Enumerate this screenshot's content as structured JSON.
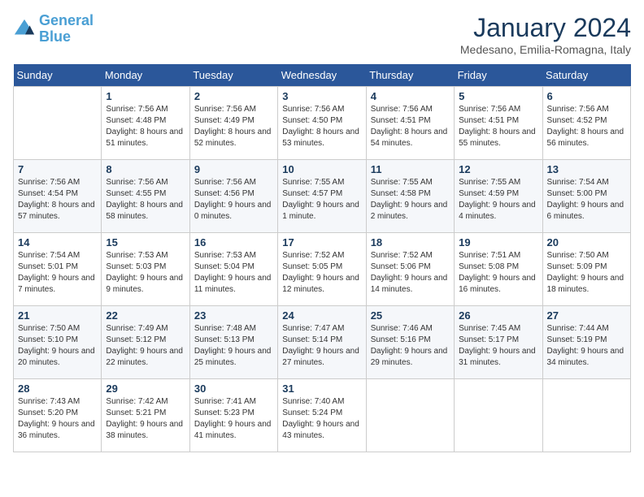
{
  "header": {
    "logo_line1": "General",
    "logo_line2": "Blue",
    "month": "January 2024",
    "location": "Medesano, Emilia-Romagna, Italy"
  },
  "days_of_week": [
    "Sunday",
    "Monday",
    "Tuesday",
    "Wednesday",
    "Thursday",
    "Friday",
    "Saturday"
  ],
  "weeks": [
    [
      {
        "day": "",
        "sunrise": "",
        "sunset": "",
        "daylight": ""
      },
      {
        "day": "1",
        "sunrise": "Sunrise: 7:56 AM",
        "sunset": "Sunset: 4:48 PM",
        "daylight": "Daylight: 8 hours and 51 minutes."
      },
      {
        "day": "2",
        "sunrise": "Sunrise: 7:56 AM",
        "sunset": "Sunset: 4:49 PM",
        "daylight": "Daylight: 8 hours and 52 minutes."
      },
      {
        "day": "3",
        "sunrise": "Sunrise: 7:56 AM",
        "sunset": "Sunset: 4:50 PM",
        "daylight": "Daylight: 8 hours and 53 minutes."
      },
      {
        "day": "4",
        "sunrise": "Sunrise: 7:56 AM",
        "sunset": "Sunset: 4:51 PM",
        "daylight": "Daylight: 8 hours and 54 minutes."
      },
      {
        "day": "5",
        "sunrise": "Sunrise: 7:56 AM",
        "sunset": "Sunset: 4:51 PM",
        "daylight": "Daylight: 8 hours and 55 minutes."
      },
      {
        "day": "6",
        "sunrise": "Sunrise: 7:56 AM",
        "sunset": "Sunset: 4:52 PM",
        "daylight": "Daylight: 8 hours and 56 minutes."
      }
    ],
    [
      {
        "day": "7",
        "sunrise": "Sunrise: 7:56 AM",
        "sunset": "Sunset: 4:54 PM",
        "daylight": "Daylight: 8 hours and 57 minutes."
      },
      {
        "day": "8",
        "sunrise": "Sunrise: 7:56 AM",
        "sunset": "Sunset: 4:55 PM",
        "daylight": "Daylight: 8 hours and 58 minutes."
      },
      {
        "day": "9",
        "sunrise": "Sunrise: 7:56 AM",
        "sunset": "Sunset: 4:56 PM",
        "daylight": "Daylight: 9 hours and 0 minutes."
      },
      {
        "day": "10",
        "sunrise": "Sunrise: 7:55 AM",
        "sunset": "Sunset: 4:57 PM",
        "daylight": "Daylight: 9 hours and 1 minute."
      },
      {
        "day": "11",
        "sunrise": "Sunrise: 7:55 AM",
        "sunset": "Sunset: 4:58 PM",
        "daylight": "Daylight: 9 hours and 2 minutes."
      },
      {
        "day": "12",
        "sunrise": "Sunrise: 7:55 AM",
        "sunset": "Sunset: 4:59 PM",
        "daylight": "Daylight: 9 hours and 4 minutes."
      },
      {
        "day": "13",
        "sunrise": "Sunrise: 7:54 AM",
        "sunset": "Sunset: 5:00 PM",
        "daylight": "Daylight: 9 hours and 6 minutes."
      }
    ],
    [
      {
        "day": "14",
        "sunrise": "Sunrise: 7:54 AM",
        "sunset": "Sunset: 5:01 PM",
        "daylight": "Daylight: 9 hours and 7 minutes."
      },
      {
        "day": "15",
        "sunrise": "Sunrise: 7:53 AM",
        "sunset": "Sunset: 5:03 PM",
        "daylight": "Daylight: 9 hours and 9 minutes."
      },
      {
        "day": "16",
        "sunrise": "Sunrise: 7:53 AM",
        "sunset": "Sunset: 5:04 PM",
        "daylight": "Daylight: 9 hours and 11 minutes."
      },
      {
        "day": "17",
        "sunrise": "Sunrise: 7:52 AM",
        "sunset": "Sunset: 5:05 PM",
        "daylight": "Daylight: 9 hours and 12 minutes."
      },
      {
        "day": "18",
        "sunrise": "Sunrise: 7:52 AM",
        "sunset": "Sunset: 5:06 PM",
        "daylight": "Daylight: 9 hours and 14 minutes."
      },
      {
        "day": "19",
        "sunrise": "Sunrise: 7:51 AM",
        "sunset": "Sunset: 5:08 PM",
        "daylight": "Daylight: 9 hours and 16 minutes."
      },
      {
        "day": "20",
        "sunrise": "Sunrise: 7:50 AM",
        "sunset": "Sunset: 5:09 PM",
        "daylight": "Daylight: 9 hours and 18 minutes."
      }
    ],
    [
      {
        "day": "21",
        "sunrise": "Sunrise: 7:50 AM",
        "sunset": "Sunset: 5:10 PM",
        "daylight": "Daylight: 9 hours and 20 minutes."
      },
      {
        "day": "22",
        "sunrise": "Sunrise: 7:49 AM",
        "sunset": "Sunset: 5:12 PM",
        "daylight": "Daylight: 9 hours and 22 minutes."
      },
      {
        "day": "23",
        "sunrise": "Sunrise: 7:48 AM",
        "sunset": "Sunset: 5:13 PM",
        "daylight": "Daylight: 9 hours and 25 minutes."
      },
      {
        "day": "24",
        "sunrise": "Sunrise: 7:47 AM",
        "sunset": "Sunset: 5:14 PM",
        "daylight": "Daylight: 9 hours and 27 minutes."
      },
      {
        "day": "25",
        "sunrise": "Sunrise: 7:46 AM",
        "sunset": "Sunset: 5:16 PM",
        "daylight": "Daylight: 9 hours and 29 minutes."
      },
      {
        "day": "26",
        "sunrise": "Sunrise: 7:45 AM",
        "sunset": "Sunset: 5:17 PM",
        "daylight": "Daylight: 9 hours and 31 minutes."
      },
      {
        "day": "27",
        "sunrise": "Sunrise: 7:44 AM",
        "sunset": "Sunset: 5:19 PM",
        "daylight": "Daylight: 9 hours and 34 minutes."
      }
    ],
    [
      {
        "day": "28",
        "sunrise": "Sunrise: 7:43 AM",
        "sunset": "Sunset: 5:20 PM",
        "daylight": "Daylight: 9 hours and 36 minutes."
      },
      {
        "day": "29",
        "sunrise": "Sunrise: 7:42 AM",
        "sunset": "Sunset: 5:21 PM",
        "daylight": "Daylight: 9 hours and 38 minutes."
      },
      {
        "day": "30",
        "sunrise": "Sunrise: 7:41 AM",
        "sunset": "Sunset: 5:23 PM",
        "daylight": "Daylight: 9 hours and 41 minutes."
      },
      {
        "day": "31",
        "sunrise": "Sunrise: 7:40 AM",
        "sunset": "Sunset: 5:24 PM",
        "daylight": "Daylight: 9 hours and 43 minutes."
      },
      {
        "day": "",
        "sunrise": "",
        "sunset": "",
        "daylight": ""
      },
      {
        "day": "",
        "sunrise": "",
        "sunset": "",
        "daylight": ""
      },
      {
        "day": "",
        "sunrise": "",
        "sunset": "",
        "daylight": ""
      }
    ]
  ]
}
